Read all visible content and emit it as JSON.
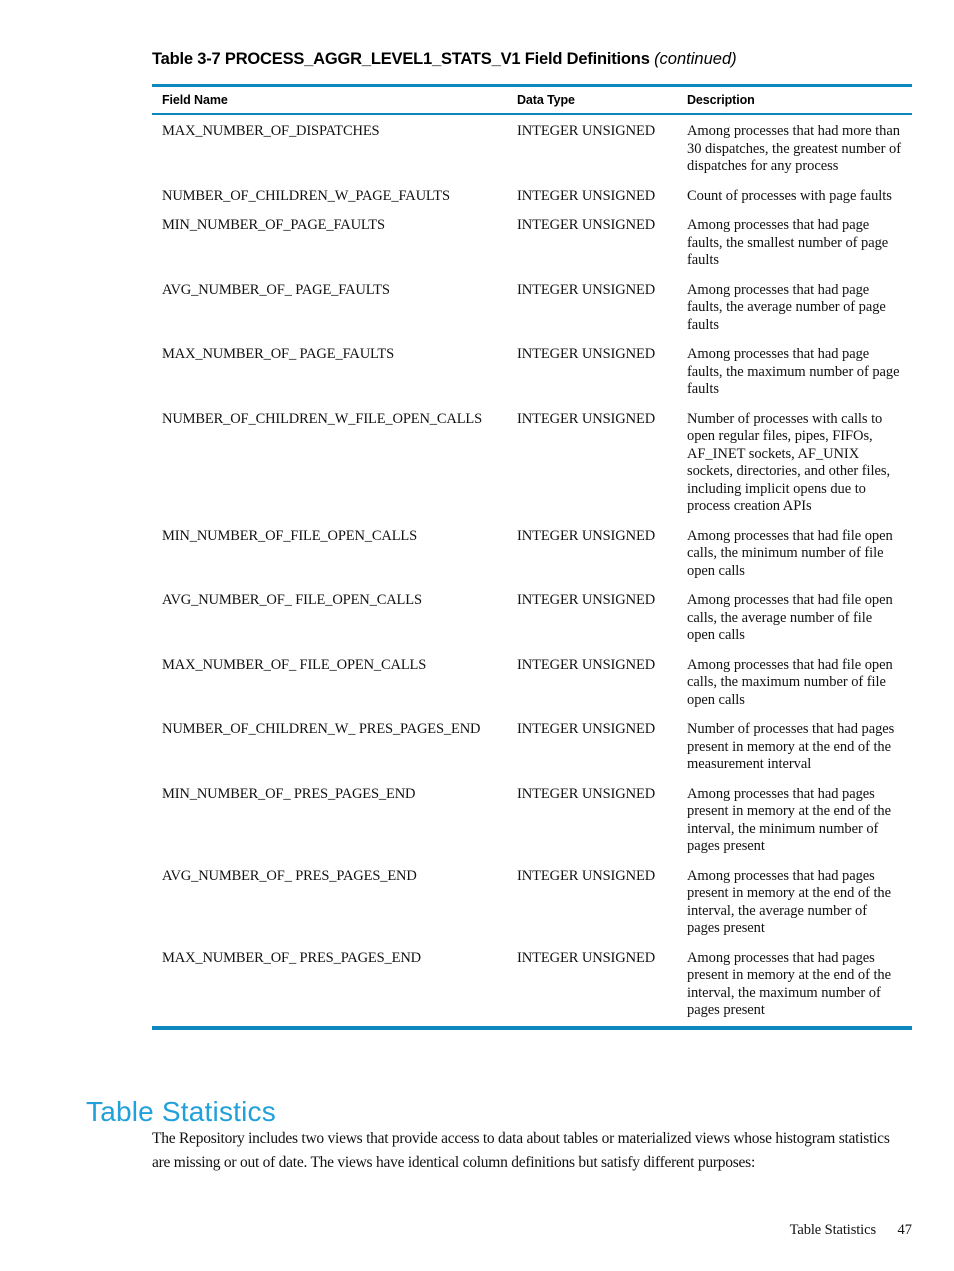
{
  "document": {
    "table_caption_main": "Table 3-7 PROCESS_AGGR_LEVEL1_STATS_V1 Field Definitions",
    "table_caption_continued": "(continued)",
    "accent_color": "#0c88bf",
    "heading_color": "#21a0da"
  },
  "table": {
    "headers": {
      "field_name": "Field Name",
      "data_type": "Data Type",
      "description": "Description"
    },
    "rows": [
      {
        "field": "MAX_NUMBER_OF_DISPATCHES",
        "type": "INTEGER UNSIGNED",
        "description": "Among processes that had more than 30 dispatches, the greatest number of dispatches for any process"
      },
      {
        "field": "NUMBER_OF_CHILDREN_W_PAGE_FAULTS",
        "type": "INTEGER UNSIGNED",
        "description": "Count of processes with page faults"
      },
      {
        "field": "MIN_NUMBER_OF_PAGE_FAULTS",
        "type": "INTEGER UNSIGNED",
        "description": "Among processes that had page faults, the smallest number of page faults"
      },
      {
        "field": "AVG_NUMBER_OF_ PAGE_FAULTS",
        "type": "INTEGER UNSIGNED",
        "description": "Among processes that had page faults, the average number of page faults"
      },
      {
        "field": "MAX_NUMBER_OF_ PAGE_FAULTS",
        "type": "INTEGER UNSIGNED",
        "description": "Among processes that had page faults, the maximum number of page faults"
      },
      {
        "field": "NUMBER_OF_CHILDREN_W_FILE_OPEN_CALLS",
        "type": "INTEGER UNSIGNED",
        "description": "Number of processes with calls to open regular files, pipes, FIFOs, AF_INET sockets, AF_UNIX sockets, directories, and other files, including implicit opens due to process creation APIs"
      },
      {
        "field": "MIN_NUMBER_OF_FILE_OPEN_CALLS",
        "type": "INTEGER UNSIGNED",
        "description": "Among processes that had file open calls, the minimum number of file open calls"
      },
      {
        "field": "AVG_NUMBER_OF_ FILE_OPEN_CALLS",
        "type": "INTEGER UNSIGNED",
        "description": "Among processes that had file open calls, the average number of file open calls"
      },
      {
        "field": "MAX_NUMBER_OF_ FILE_OPEN_CALLS",
        "type": "INTEGER UNSIGNED",
        "description": "Among processes that had file open calls, the maximum number of file open calls"
      },
      {
        "field": "NUMBER_OF_CHILDREN_W_ PRES_PAGES_END",
        "type": "INTEGER UNSIGNED",
        "description": "Number of processes that had pages present in memory at the end of the measurement interval"
      },
      {
        "field": "MIN_NUMBER_OF_ PRES_PAGES_END",
        "type": "INTEGER UNSIGNED",
        "description": "Among processes that had pages present in memory at the end of the interval, the minimum number of pages present"
      },
      {
        "field": "AVG_NUMBER_OF_ PRES_PAGES_END",
        "type": "INTEGER UNSIGNED",
        "description": "Among processes that had pages present in memory at the end of the interval, the average number of pages present"
      },
      {
        "field": "MAX_NUMBER_OF_ PRES_PAGES_END",
        "type": "INTEGER UNSIGNED",
        "description": "Among processes that had pages present in memory at the end of the interval, the maximum number of pages present"
      }
    ]
  },
  "section": {
    "heading": "Table Statistics",
    "paragraph": "The Repository includes two views that provide access to data about tables or materialized views whose histogram statistics are missing or out of date. The views have identical column definitions but satisfy different purposes:"
  },
  "footer": {
    "label": "Table Statistics",
    "page_number": "47"
  }
}
